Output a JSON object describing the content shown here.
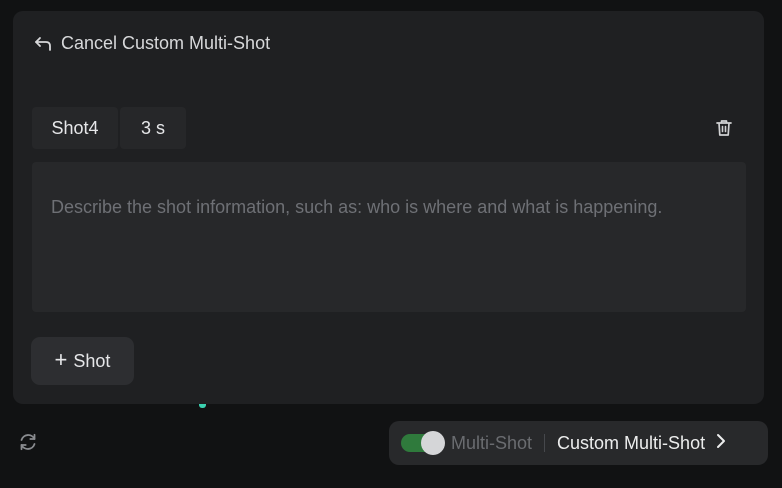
{
  "header": {
    "back_label": "Cancel Custom Multi-Shot"
  },
  "shot": {
    "name": "Shot4",
    "duration": "3 s"
  },
  "description": {
    "placeholder": "Describe the shot information, such as: who is where and what is happening."
  },
  "add_shot": {
    "label": "Shot"
  },
  "bottom_bar": {
    "toggle_on": true,
    "multi_shot_label": "Multi-Shot",
    "custom_label": "Custom Multi-Shot"
  },
  "colors": {
    "toggle_on": "#2f7a3c",
    "accent_dot": "#3bd1b0"
  },
  "icons": {
    "back": "back-arrow-icon",
    "delete": "trash-icon",
    "add": "plus-icon",
    "refresh": "refresh-icon",
    "forward": "chevron-right-icon"
  }
}
